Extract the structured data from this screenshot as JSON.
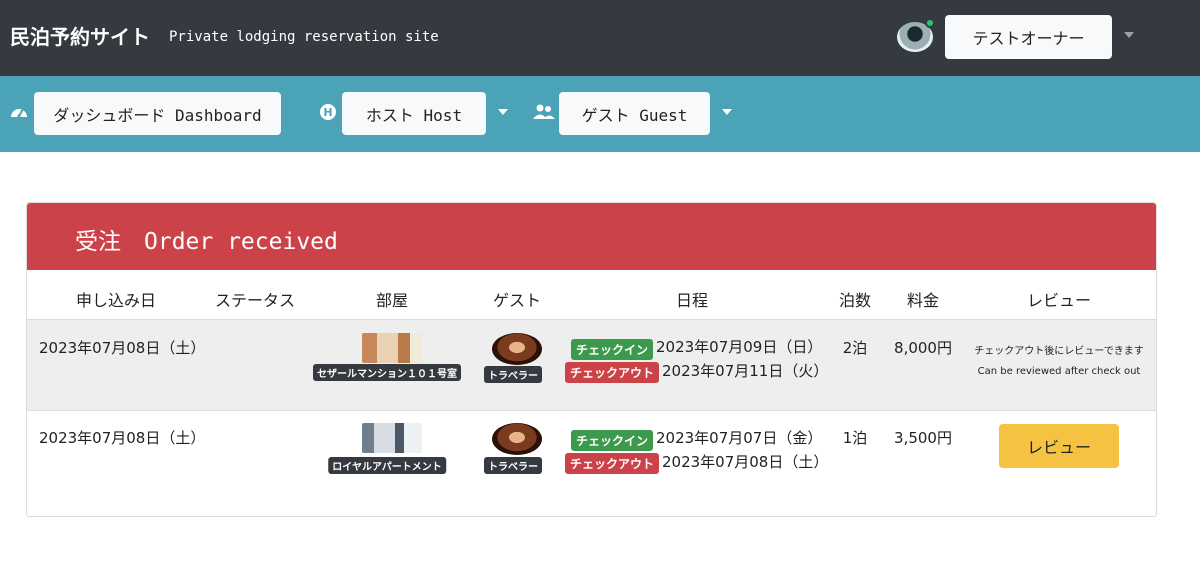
{
  "header": {
    "brand": "民泊予約サイト",
    "tagline": "Private lodging reservation site",
    "user_name": "テストオーナー"
  },
  "nav": {
    "dashboard": "ダッシュボード Dashboard",
    "host": "ホスト Host",
    "guest": "ゲスト Guest",
    "icons": [
      "speedometer-icon",
      "hotel-h-icon",
      "users-icon"
    ]
  },
  "card": {
    "title": "受注　Order received",
    "columns": {
      "applied": "申し込み日",
      "status": "ステータス",
      "room": "部屋",
      "guest": "ゲスト",
      "schedule": "日程",
      "nights": "泊数",
      "price": "料金",
      "review": "レビュー"
    },
    "rows": [
      {
        "applied": "2023年07月08日（土）",
        "status": "",
        "room": "セザールマンション１０１号室",
        "guest": "トラベラー",
        "checkin_label": "チェックイン",
        "checkin": "2023年07月09日（日）",
        "checkout_label": "チェックアウト",
        "checkout": "2023年07月11日（火）",
        "nights": "2泊",
        "price": "8,000円",
        "review_note_jp": "チェックアウト後にレビューできます",
        "review_note_en": "Can be reviewed after check out"
      },
      {
        "applied": "2023年07月08日（土）",
        "status": "",
        "room": "ロイヤルアパートメント",
        "guest": "トラベラー",
        "checkin_label": "チェックイン",
        "checkin": "2023年07月07日（金）",
        "checkout_label": "チェックアウト",
        "checkout": "2023年07月08日（土）",
        "nights": "1泊",
        "price": "3,500円",
        "review_button": "レビュー"
      }
    ]
  },
  "colors": {
    "topbar": "#343a40",
    "navbar": "#4aa3b6",
    "card_header": "#cc4249",
    "checkin_badge": "#3d9a4d",
    "checkout_badge": "#cc4249",
    "review_button": "#f5c242"
  }
}
